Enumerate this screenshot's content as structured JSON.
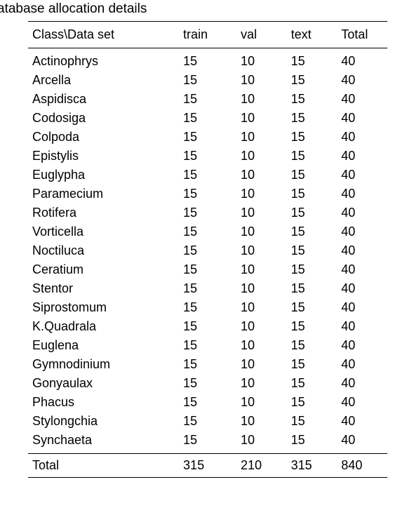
{
  "caption": "atabase allocation details",
  "headers": [
    "Class\\Data set",
    "train",
    "val",
    "text",
    "Total"
  ],
  "rows": [
    {
      "class": "Actinophrys",
      "train": 15,
      "val": 10,
      "text": 15,
      "total": 40
    },
    {
      "class": "Arcella",
      "train": 15,
      "val": 10,
      "text": 15,
      "total": 40
    },
    {
      "class": "Aspidisca",
      "train": 15,
      "val": 10,
      "text": 15,
      "total": 40
    },
    {
      "class": "Codosiga",
      "train": 15,
      "val": 10,
      "text": 15,
      "total": 40
    },
    {
      "class": "Colpoda",
      "train": 15,
      "val": 10,
      "text": 15,
      "total": 40
    },
    {
      "class": "Epistylis",
      "train": 15,
      "val": 10,
      "text": 15,
      "total": 40
    },
    {
      "class": "Euglypha",
      "train": 15,
      "val": 10,
      "text": 15,
      "total": 40
    },
    {
      "class": "Paramecium",
      "train": 15,
      "val": 10,
      "text": 15,
      "total": 40
    },
    {
      "class": "Rotifera",
      "train": 15,
      "val": 10,
      "text": 15,
      "total": 40
    },
    {
      "class": "Vorticella",
      "train": 15,
      "val": 10,
      "text": 15,
      "total": 40
    },
    {
      "class": "Noctiluca",
      "train": 15,
      "val": 10,
      "text": 15,
      "total": 40
    },
    {
      "class": "Ceratium",
      "train": 15,
      "val": 10,
      "text": 15,
      "total": 40
    },
    {
      "class": "Stentor",
      "train": 15,
      "val": 10,
      "text": 15,
      "total": 40
    },
    {
      "class": "Siprostomum",
      "train": 15,
      "val": 10,
      "text": 15,
      "total": 40
    },
    {
      "class": "K.Quadrala",
      "train": 15,
      "val": 10,
      "text": 15,
      "total": 40
    },
    {
      "class": "Euglena",
      "train": 15,
      "val": 10,
      "text": 15,
      "total": 40
    },
    {
      "class": "Gymnodinium",
      "train": 15,
      "val": 10,
      "text": 15,
      "total": 40
    },
    {
      "class": "Gonyaulax",
      "train": 15,
      "val": 10,
      "text": 15,
      "total": 40
    },
    {
      "class": "Phacus",
      "train": 15,
      "val": 10,
      "text": 15,
      "total": 40
    },
    {
      "class": "Stylongchia",
      "train": 15,
      "val": 10,
      "text": 15,
      "total": 40
    },
    {
      "class": "Synchaeta",
      "train": 15,
      "val": 10,
      "text": 15,
      "total": 40
    }
  ],
  "totals": {
    "label": "Total",
    "train": 315,
    "val": 210,
    "text": 315,
    "total": 840
  }
}
